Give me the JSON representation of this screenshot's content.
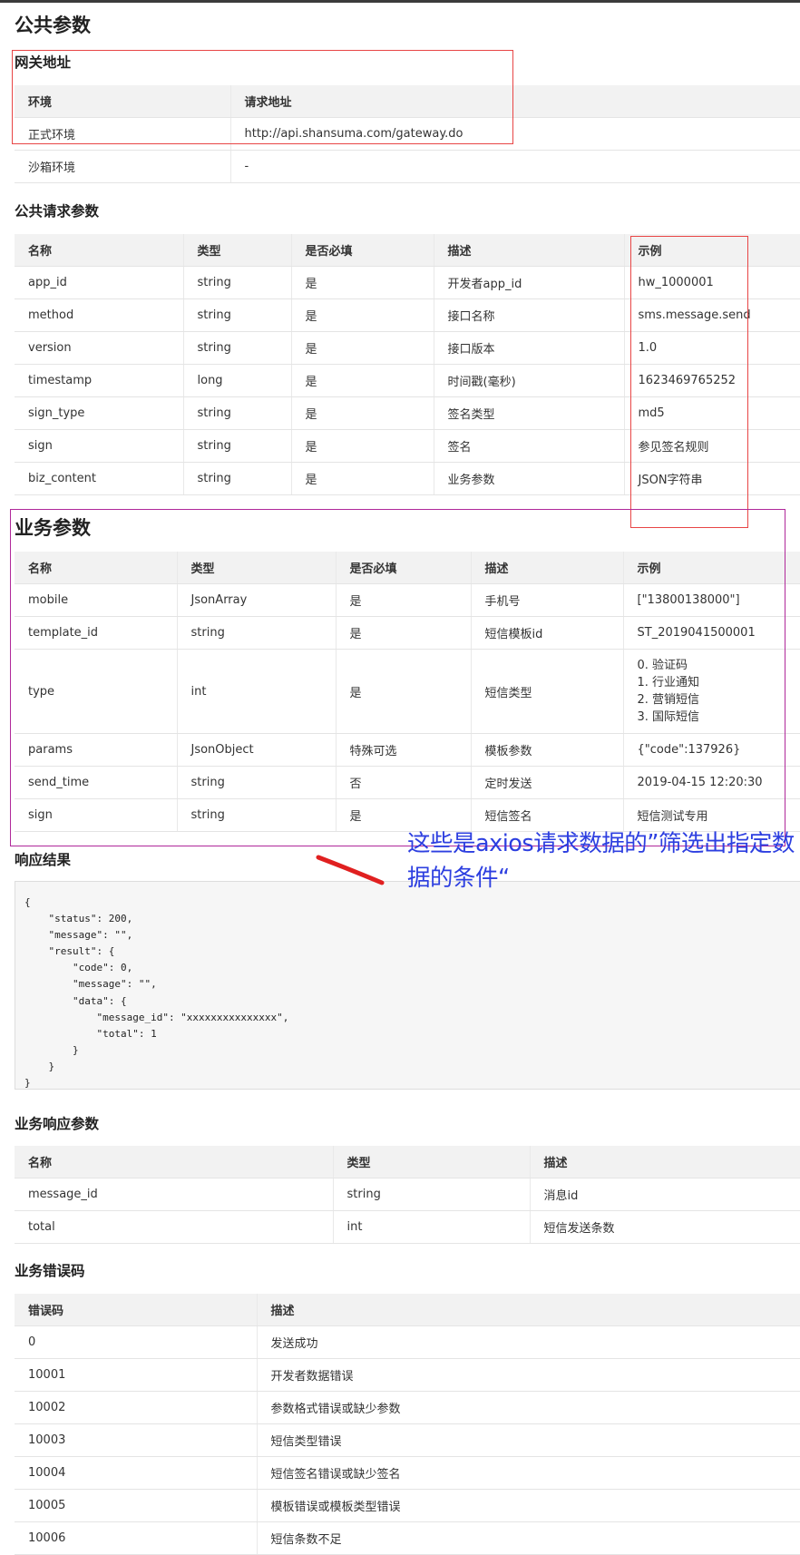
{
  "public_params": {
    "title": "公共参数",
    "gateway": {
      "title": "网关地址",
      "headers": [
        "环境",
        "请求地址"
      ],
      "rows": [
        [
          "正式环境",
          "http://api.shansuma.com/gateway.do"
        ],
        [
          "沙箱环境",
          "-"
        ]
      ]
    },
    "request": {
      "title": "公共请求参数",
      "headers": [
        "名称",
        "类型",
        "是否必填",
        "描述",
        "示例"
      ],
      "rows": [
        [
          "app_id",
          "string",
          "是",
          "开发者app_id",
          "hw_1000001"
        ],
        [
          "method",
          "string",
          "是",
          "接口名称",
          "sms.message.send"
        ],
        [
          "version",
          "string",
          "是",
          "接口版本",
          "1.0"
        ],
        [
          "timestamp",
          "long",
          "是",
          "时间戳(毫秒)",
          "1623469765252"
        ],
        [
          "sign_type",
          "string",
          "是",
          "签名类型",
          "md5"
        ],
        [
          "sign",
          "string",
          "是",
          "签名",
          "参见签名规则"
        ],
        [
          "biz_content",
          "string",
          "是",
          "业务参数",
          "JSON字符串"
        ]
      ]
    }
  },
  "biz_params": {
    "title": "业务参数",
    "headers": [
      "名称",
      "类型",
      "是否必填",
      "描述",
      "示例"
    ],
    "rows": [
      [
        "mobile",
        "JsonArray",
        "是",
        "手机号",
        "[\"13800138000\"]"
      ],
      [
        "template_id",
        "string",
        "是",
        "短信模板id",
        "ST_2019041500001"
      ],
      [
        "params",
        "JsonObject",
        "特殊可选",
        "模板参数",
        "{\"code\":137926}"
      ],
      [
        "send_time",
        "string",
        "否",
        "定时发送",
        "2019-04-15 12:20:30"
      ],
      [
        "sign",
        "string",
        "是",
        "短信签名",
        "短信测试专用"
      ]
    ],
    "type_row": {
      "name": "type",
      "type": "int",
      "required": "是",
      "desc": "短信类型",
      "examples": [
        "0. 验证码",
        "1. 行业通知",
        "2. 营销短信",
        "3. 国际短信"
      ]
    }
  },
  "response": {
    "title": "响应结果",
    "code": "{\n    \"status\": 200,\n    \"message\": \"\",\n    \"result\": {\n        \"code\": 0,\n        \"message\": \"\",\n        \"data\": {\n            \"message_id\": \"xxxxxxxxxxxxxxx\",\n            \"total\": 1\n        }\n    }\n}"
  },
  "biz_response": {
    "title": "业务响应参数",
    "headers": [
      "名称",
      "类型",
      "描述"
    ],
    "rows": [
      [
        "message_id",
        "string",
        "消息id"
      ],
      [
        "total",
        "int",
        "短信发送条数"
      ]
    ]
  },
  "biz_errors": {
    "title": "业务错误码",
    "headers": [
      "错误码",
      "描述"
    ],
    "rows": [
      [
        "0",
        "发送成功"
      ],
      [
        "10001",
        "开发者数据错误"
      ],
      [
        "10002",
        "参数格式错误或缺少参数"
      ],
      [
        "10003",
        "短信类型错误"
      ],
      [
        "10004",
        "短信签名错误或缺少签名"
      ],
      [
        "10005",
        "模板错误或模板类型错误"
      ],
      [
        "10006",
        "短信条数不足"
      ]
    ]
  },
  "annotation": {
    "text": "这些是axios请求数据的”筛选出指定数据的条件“",
    "colors": {
      "text": "#2d3fe0",
      "stroke": "#e02020",
      "red_box": "#e84545",
      "purple_box": "#b0289a"
    }
  }
}
